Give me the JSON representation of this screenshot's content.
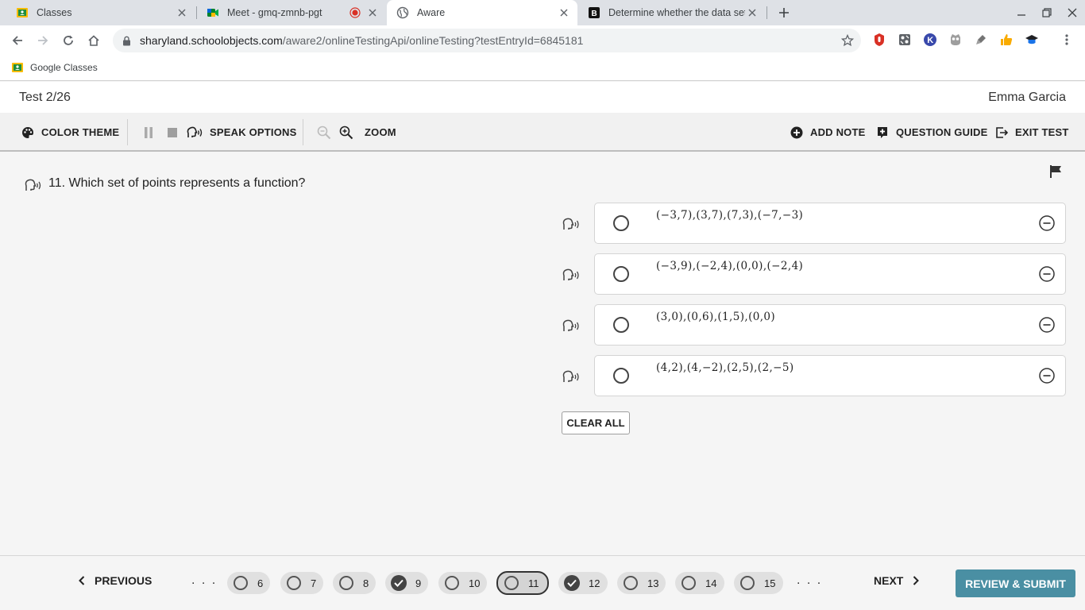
{
  "browser": {
    "tabs": [
      {
        "title": "Classes"
      },
      {
        "title": "Meet - gmq-zmnb-pgt"
      },
      {
        "title": "Aware"
      },
      {
        "title": "Determine whether the data sets"
      }
    ],
    "url_host": "sharyland.schoolobjects.com",
    "url_path": "/aware2/onlineTestingApi/onlineTesting?testEntryId=6845181",
    "bookmark": "Google Classes"
  },
  "header": {
    "test_title": "Test 2/26",
    "student_name": "Emma Garcia"
  },
  "toolbar": {
    "color_theme": "COLOR THEME",
    "speak_options": "SPEAK OPTIONS",
    "zoom": "ZOOM",
    "add_note": "ADD NOTE",
    "question_guide": "QUESTION GUIDE",
    "exit_test": "EXIT TEST"
  },
  "question": {
    "text": "11. Which set of points represents a function?",
    "options": [
      {
        "text": "(−3,7),(3,7),(7,3),(−7,−3)"
      },
      {
        "text": "(−3,9),(−2,4),(0,0),(−2,4)"
      },
      {
        "text": "(3,0),(0,6),(1,5),(0,0)"
      },
      {
        "text": "(4,2),(4,−2),(2,5),(2,−5)"
      }
    ],
    "clear_all": "CLEAR ALL"
  },
  "navigation": {
    "previous": "PREVIOUS",
    "next": "NEXT",
    "ellipsis": ". . .",
    "questions": [
      {
        "number": "6",
        "answered": false
      },
      {
        "number": "7",
        "answered": false
      },
      {
        "number": "8",
        "answered": false
      },
      {
        "number": "9",
        "answered": true
      },
      {
        "number": "10",
        "answered": false
      },
      {
        "number": "11",
        "answered": false,
        "current": true
      },
      {
        "number": "12",
        "answered": true
      },
      {
        "number": "13",
        "answered": false
      },
      {
        "number": "14",
        "answered": false
      },
      {
        "number": "15",
        "answered": false
      }
    ],
    "submit": "REVIEW & SUBMIT"
  },
  "colors": {
    "accent": "#4a8fa3",
    "recording": "#d93025"
  }
}
